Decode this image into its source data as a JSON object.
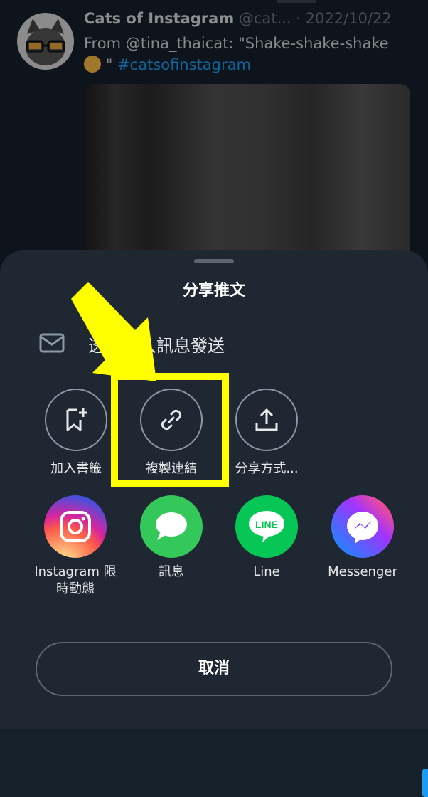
{
  "tweet": {
    "account_name": "Cats of Instagram",
    "handle": "@cat...",
    "separator": "·",
    "date": "2022/10/22",
    "text_part1": "From @tina_thaicat: \"Shake-shake-shake",
    "text_part2": "\"",
    "hashtag": "#catsofinstagram"
  },
  "share_sheet": {
    "title": "分享推文",
    "dm_label": "透過私人訊息發送",
    "actions": [
      {
        "label": "加入書籤",
        "icon": "bookmark-add-icon"
      },
      {
        "label": "複製連結",
        "icon": "link-icon"
      },
      {
        "label": "分享方式...",
        "icon": "share-icon"
      }
    ],
    "apps": [
      {
        "label": "Instagram 限",
        "label2": "時動態",
        "icon": "instagram-icon"
      },
      {
        "label": "訊息",
        "icon": "messages-icon"
      },
      {
        "label": "Line",
        "icon": "line-icon",
        "icon_text": "LINE"
      },
      {
        "label": "Messenger",
        "icon": "messenger-icon"
      }
    ],
    "cancel_label": "取消"
  },
  "colors": {
    "background": "#15202b",
    "sheet": "#1e2732",
    "highlight": "#ffff00",
    "hashtag": "#1d9bf0"
  }
}
